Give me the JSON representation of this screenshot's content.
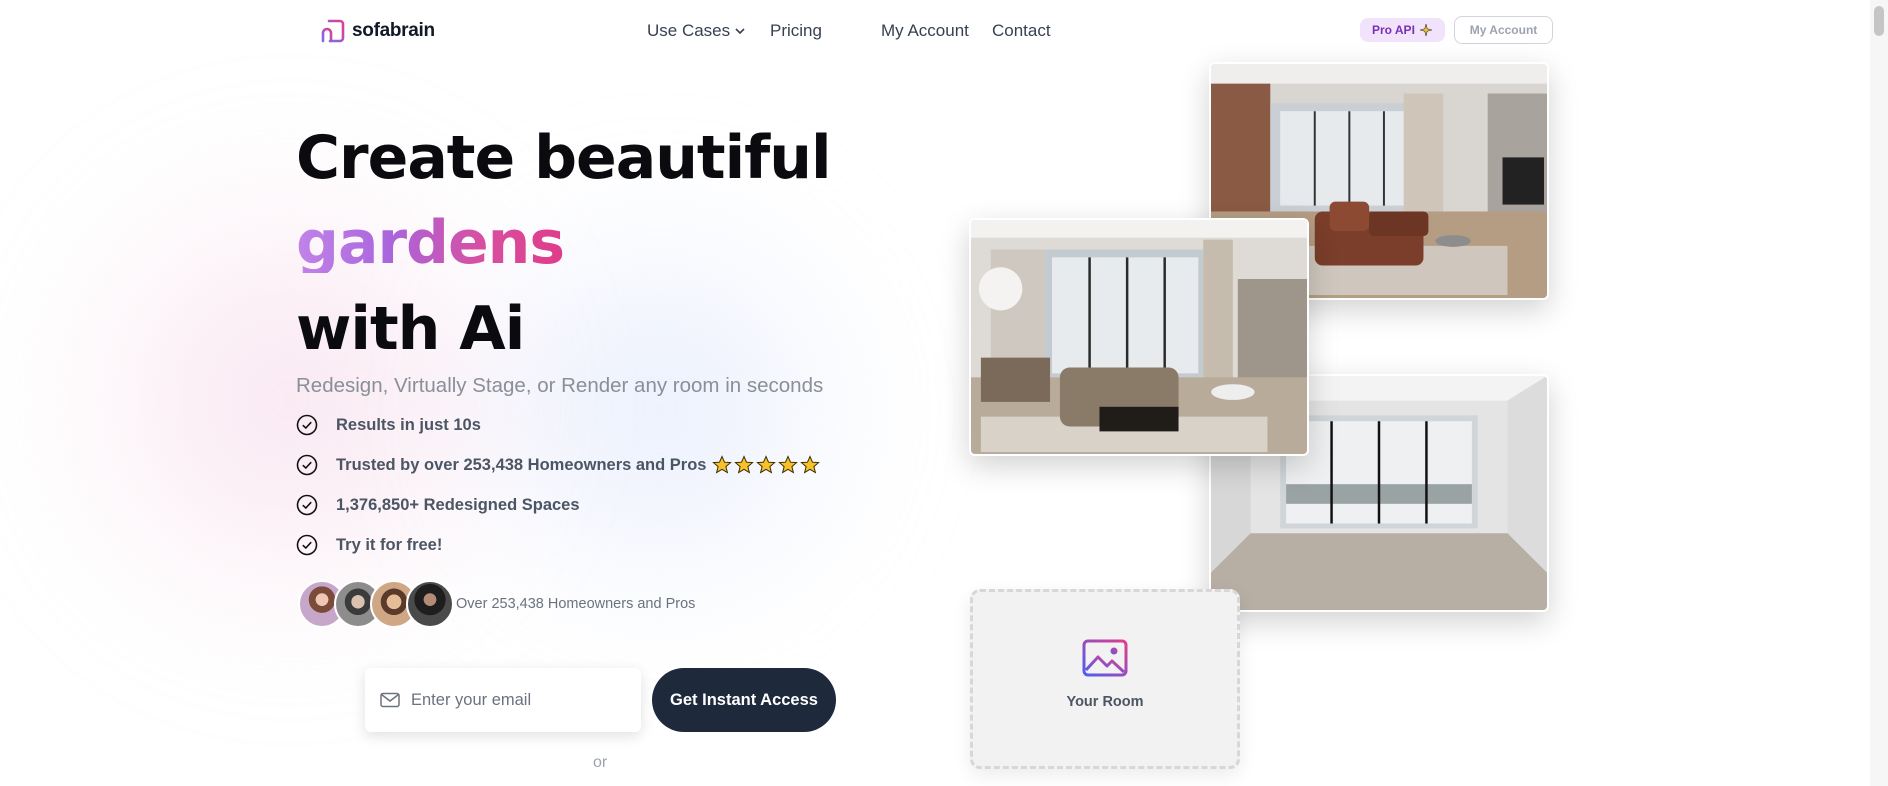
{
  "nav": {
    "brand": "sofabrain",
    "links": [
      {
        "label": "Use Cases",
        "dropdown": true
      },
      {
        "label": "Pricing"
      },
      {
        "label": "My Account"
      },
      {
        "label": "Contact"
      }
    ],
    "pro_api_label": "Pro API",
    "account_button": "My Account"
  },
  "hero": {
    "title_line1": "Create beautiful",
    "title_highlight": "gardens",
    "title_line3": "with Ai",
    "subtitle": "Redesign, Virtually Stage, or Render any room in seconds",
    "features": [
      "Results in just 10s",
      "Trusted by over 253,438 Homeowners and Pros",
      "1,376,850+ Redesigned Spaces",
      "Try it for free!"
    ],
    "rating_stars": 5,
    "social_proof": "Over 253,438 Homeowners and Pros",
    "email_placeholder": "Enter your email",
    "cta_label": "Get Instant Access",
    "or_text": "or"
  },
  "upload": {
    "label": "Your Room"
  },
  "colors": {
    "cta_bg": "#1e293b",
    "gradient_start": "#c184e8",
    "gradient_end": "#df3c8a",
    "pro_badge_bg": "#f1e3fb",
    "pro_badge_text": "#7a2fb5",
    "star": "#f6c12c"
  }
}
